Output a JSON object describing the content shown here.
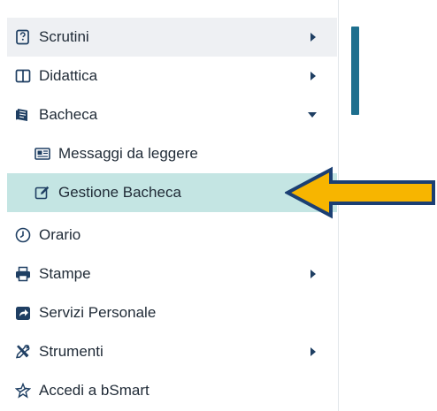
{
  "sidebar": {
    "items": [
      {
        "label": "Scrutini",
        "icon": "scrutini-icon",
        "submenu": true
      },
      {
        "label": "Didattica",
        "icon": "book-icon",
        "submenu": true
      },
      {
        "label": "Bacheca",
        "icon": "bacheca-icon",
        "submenu": "expanded"
      },
      {
        "label": "Messaggi da leggere",
        "icon": "newspaper-icon"
      },
      {
        "label": "Gestione Bacheca",
        "icon": "edit-icon",
        "active": true
      },
      {
        "label": "Orario",
        "icon": "clock-icon"
      },
      {
        "label": "Stampe",
        "icon": "printer-icon",
        "submenu": true
      },
      {
        "label": "Servizi Personale",
        "icon": "share-icon"
      },
      {
        "label": "Strumenti",
        "icon": "tools-icon",
        "submenu": true
      },
      {
        "label": "Accedi a bSmart",
        "icon": "bsmart-icon"
      }
    ]
  },
  "colors": {
    "active_bg": "#c4e5e3",
    "hover_bg": "#eef0f3",
    "accent": "#1e6f8e",
    "icon": "#1f3f63",
    "pointer_fill": "#f7b500",
    "pointer_stroke": "#1b3f73"
  }
}
